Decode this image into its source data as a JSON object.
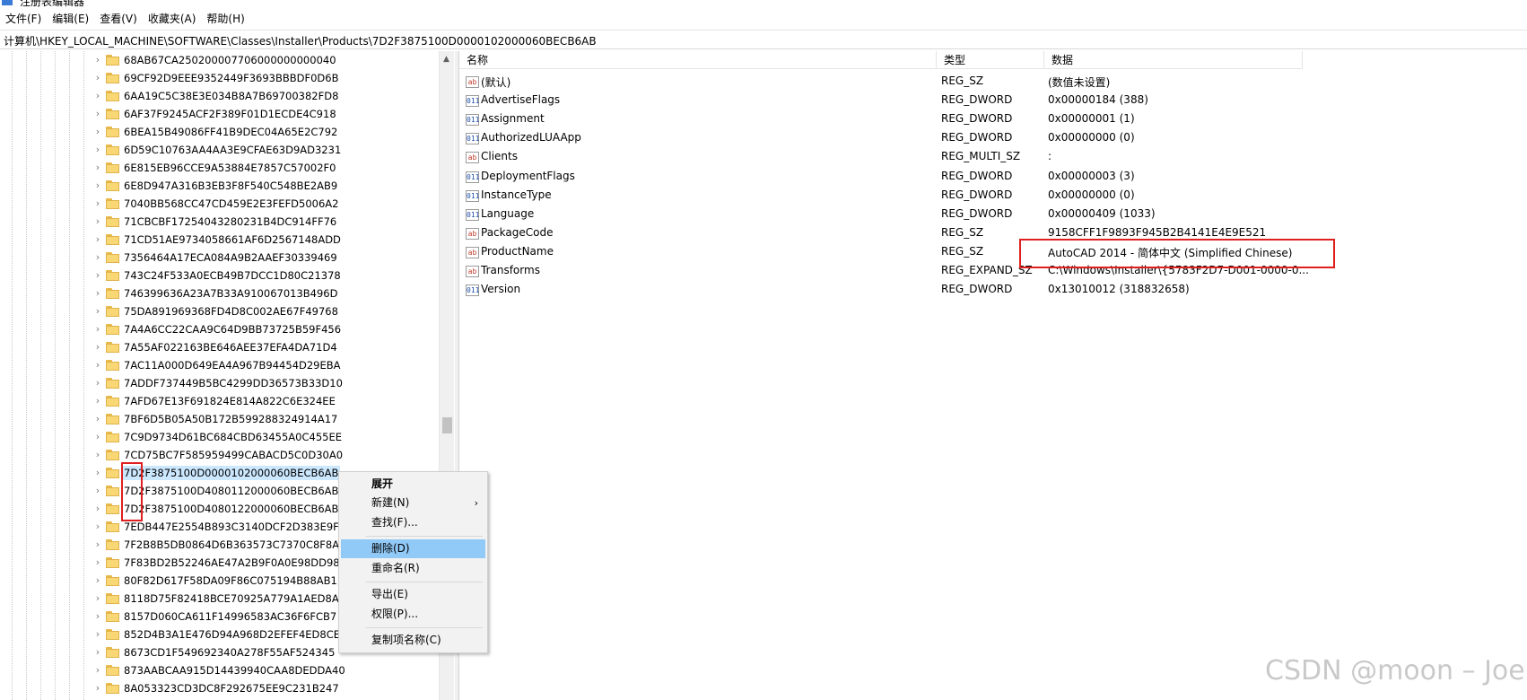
{
  "window": {
    "title": "注册表编辑器"
  },
  "menu": [
    "文件(F)",
    "编辑(E)",
    "查看(V)",
    "收藏夹(A)",
    "帮助(H)"
  ],
  "address": "计算机\\HKEY_LOCAL_MACHINE\\SOFTWARE\\Classes\\Installer\\Products\\7D2F3875100D0000102000060BECB6AB",
  "tree": {
    "items": [
      "68AB67CA250200007706000000000040",
      "69CF92D9EEE9352449F3693BBBDF0D6B",
      "6AA19C5C38E3E034B8A7B69700382FD8",
      "6AF37F9245ACF2F389F01D1ECDE4C918",
      "6BEA15B49086FF41B9DEC04A65E2C792",
      "6D59C10763AA4AA3E9CFAE63D9AD3231",
      "6E815EB96CCE9A53884E7857C57002F0",
      "6E8D947A316B3EB3F8F540C548BE2AB9",
      "7040BB568CC47CD459E2E3FEFD5006A2",
      "71CBCBF17254043280231B4DC914FF76",
      "71CD51AE9734058661AF6D2567148ADD",
      "7356464A17ECA084A9B2AAEF30339469",
      "743C24F533A0ECB49B7DCC1D80C21378",
      "746399636A23A7B33A910067013B496D",
      "75DA891969368FD4D8C002AE67F49768",
      "7A4A6CC22CAA9C64D9BB73725B59F456",
      "7A55AF022163BE646AEE37EFA4DA71D4",
      "7AC11A000D649EA4A967B94454D29EBA",
      "7ADDF737449B5BC4299DD36573B33D10",
      "7AFD67E13F691824E814A822C6E324EE",
      "7BF6D5B05A50B172B599288324914A17",
      "7C9D9734D61BC684CBD63455A0C455EE",
      "7CD75BC7F585959499CABACD5C0D30A0",
      "7D2F3875100D0000102000060BECB6AB",
      "7D2F3875100D4080112000060BECB6AB",
      "7D2F3875100D4080122000060BECB6AB",
      "7EDB447E2554B893C3140DCF2D383E9F",
      "7F2B8B5DB0864D6B363573C7370C8F8A",
      "7F83BD2B52246AE47A2B9F0A0E98DD98",
      "80F82D617F58DA09F86C075194B88AB1",
      "8118D75F82418BCE70925A779A1AED8A",
      "8157D060CA611F14996583AC36F6FCB7",
      "852D4B3A1E476D94A968D2EFEF4ED8CE",
      "8673CD1F549692340A278F55AF524345",
      "873AABCAA915D14439940CAA8DEDDA40",
      "8A053323CD3DC8F292675EE9C231B247"
    ],
    "selected_index": 23
  },
  "values": {
    "headers": {
      "name": "名称",
      "type": "类型",
      "data": "数据"
    },
    "rows": [
      {
        "icon": "sz",
        "name": "(默认)",
        "type": "REG_SZ",
        "data": "(数值未设置)"
      },
      {
        "icon": "bin",
        "name": "AdvertiseFlags",
        "type": "REG_DWORD",
        "data": "0x00000184 (388)"
      },
      {
        "icon": "bin",
        "name": "Assignment",
        "type": "REG_DWORD",
        "data": "0x00000001 (1)"
      },
      {
        "icon": "bin",
        "name": "AuthorizedLUAApp",
        "type": "REG_DWORD",
        "data": "0x00000000 (0)"
      },
      {
        "icon": "sz",
        "name": "Clients",
        "type": "REG_MULTI_SZ",
        "data": ":"
      },
      {
        "icon": "bin",
        "name": "DeploymentFlags",
        "type": "REG_DWORD",
        "data": "0x00000003 (3)"
      },
      {
        "icon": "bin",
        "name": "InstanceType",
        "type": "REG_DWORD",
        "data": "0x00000000 (0)"
      },
      {
        "icon": "bin",
        "name": "Language",
        "type": "REG_DWORD",
        "data": "0x00000409 (1033)"
      },
      {
        "icon": "sz",
        "name": "PackageCode",
        "type": "REG_SZ",
        "data": "9158CFF1F9893F945B2B4141E4E9E521"
      },
      {
        "icon": "sz",
        "name": "ProductName",
        "type": "REG_SZ",
        "data": "AutoCAD 2014 - 简体中文 (Simplified Chinese)"
      },
      {
        "icon": "sz",
        "name": "Transforms",
        "type": "REG_EXPAND_SZ",
        "data": "C:\\Windows\\Installer\\{5783F2D7-D001-0000-0..."
      },
      {
        "icon": "bin",
        "name": "Version",
        "type": "REG_DWORD",
        "data": "0x13010012 (318832658)"
      }
    ],
    "icon_labels": {
      "sz": "ab",
      "bin": "011"
    }
  },
  "context_menu": {
    "expand": "展开",
    "new": "新建(N)",
    "find": "查找(F)...",
    "delete": "删除(D)",
    "rename": "重命名(R)",
    "export": "导出(E)",
    "permissions": "权限(P)...",
    "copy_key_name": "复制项名称(C)",
    "submenu_arrow": "›"
  },
  "watermark": "CSDN @moon – Joe",
  "colors": {
    "selection": "#cce8ff",
    "menu_highlight": "#91c9f7",
    "annotation_red": "#e02020",
    "folder": "#f8d774"
  }
}
